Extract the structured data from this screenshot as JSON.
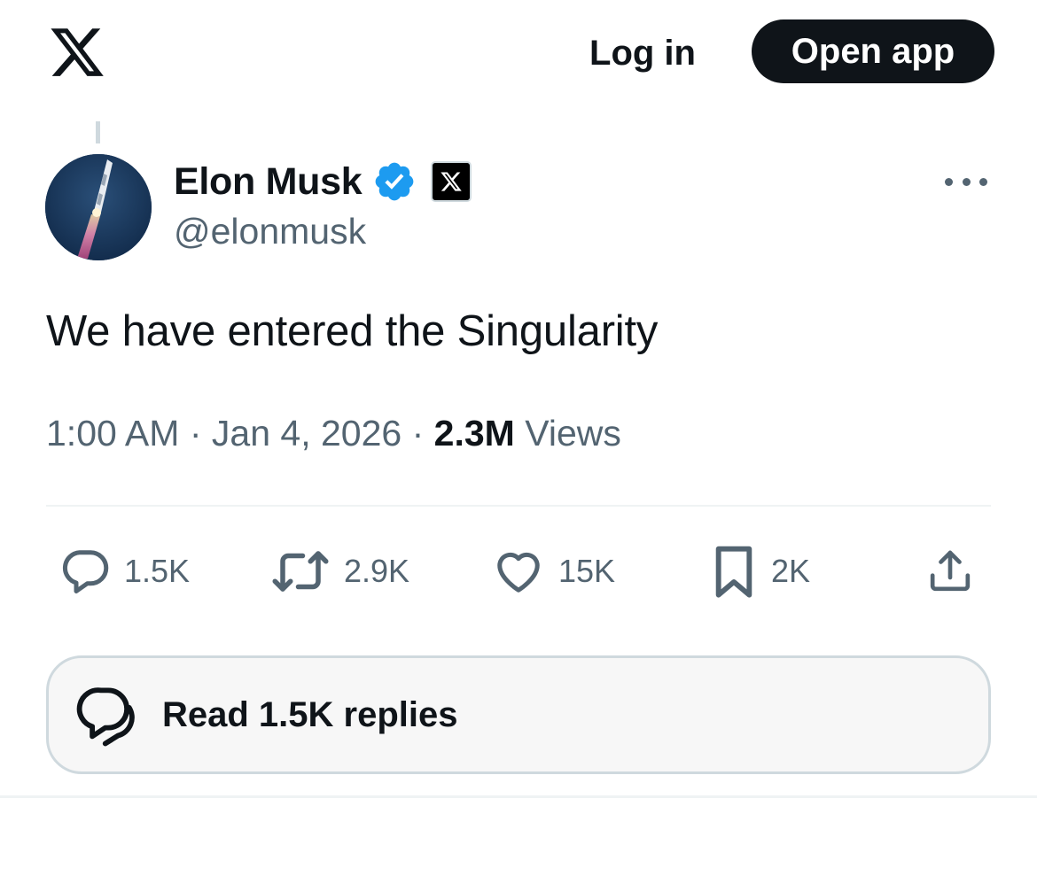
{
  "header": {
    "logo_icon": "x-logo-icon",
    "login_label": "Log in",
    "open_app_label": "Open app"
  },
  "tweet": {
    "author": {
      "display_name": "Elon Musk",
      "handle": "@elonmusk",
      "verified_icon": "verified-badge-icon",
      "affiliate_icon": "x-affiliate-badge-icon",
      "avatar_icon": "rocket-avatar"
    },
    "more_icon": "more-dots-icon",
    "text": "We have entered the Singularity",
    "time": "1:00 AM",
    "separator": "·",
    "date": "Jan 4, 2026",
    "views_count": "2.3M",
    "views_label": "Views",
    "actions": {
      "reply": {
        "icon": "reply-icon",
        "count": "1.5K"
      },
      "repost": {
        "icon": "repost-icon",
        "count": "2.9K"
      },
      "like": {
        "icon": "heart-icon",
        "count": "15K"
      },
      "bookmark": {
        "icon": "bookmark-icon",
        "count": "2K"
      },
      "share": {
        "icon": "share-icon"
      }
    },
    "read_replies_label": "Read 1.5K replies"
  },
  "colors": {
    "text_primary": "#0f1419",
    "text_secondary": "#536471",
    "verified_blue": "#1d9bf0",
    "button_dark": "#0f1419",
    "border": "#cfd9de",
    "divider": "#eff3f4",
    "replies_bg": "#f7f7f7"
  }
}
